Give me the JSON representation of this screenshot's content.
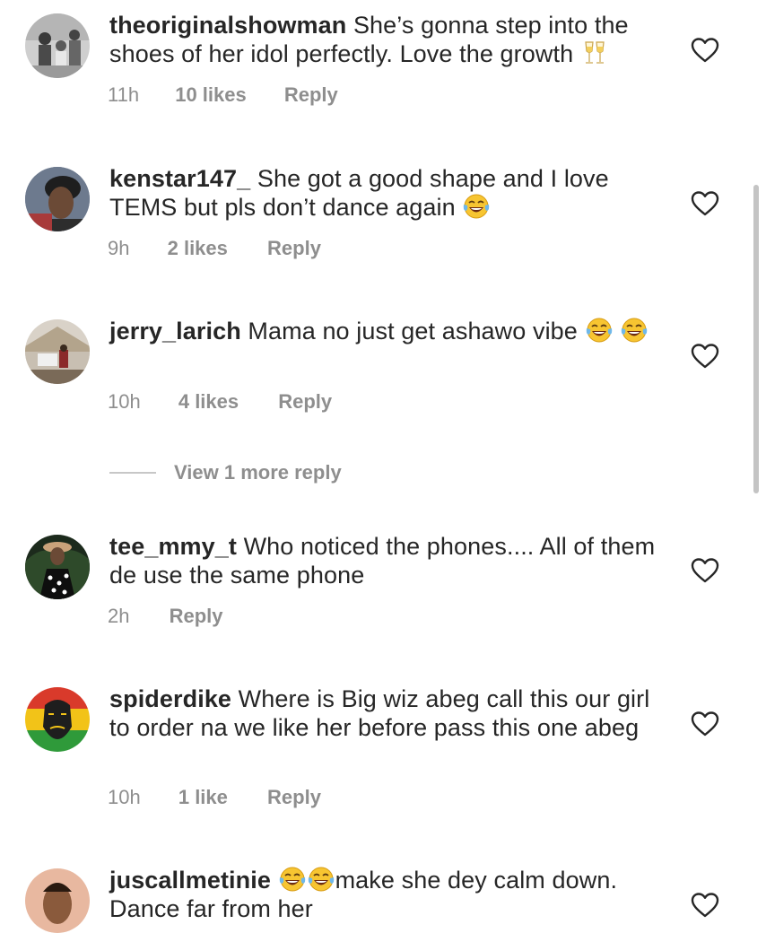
{
  "comments": [
    {
      "username": "theoriginalshowman",
      "text": "She’s gonna step into the shoes of her idol perfectly. Love the growth",
      "emoji": "clinking-glasses-emoji",
      "time": "11h",
      "likes": "10 likes",
      "reply": "Reply"
    },
    {
      "username": "kenstar147_",
      "text": "She got a good shape and I love TEMS but pls don’t dance again",
      "emoji": "tears-of-joy-emoji",
      "time": "9h",
      "likes": "2 likes",
      "reply": "Reply"
    },
    {
      "username": "jerry_larich",
      "text": "Mama no just get ashawo vibe",
      "emoji": "tears-of-joy-emoji",
      "time": "10h",
      "likes": "4 likes",
      "reply": "Reply"
    },
    {
      "username": "tee_mmy_t",
      "text": "Who noticed the phones.... All of them de use the same phone",
      "time": "2h",
      "reply": "Reply"
    },
    {
      "username": "spiderdike",
      "text": "Where is Big wiz abeg call this our girl to order na we like her before pass this one abeg",
      "time": "10h",
      "likes": "1 like",
      "reply": "Reply"
    },
    {
      "username": "juscallmetinie",
      "text": "make she dey calm down. Dance far from her",
      "emoji": "tears-of-joy-emoji"
    }
  ],
  "view_more": "View 1 more reply",
  "icons": {
    "like": "heart-outline-icon"
  },
  "colors": {
    "text": "#262626",
    "secondary": "#8e8e8e"
  }
}
